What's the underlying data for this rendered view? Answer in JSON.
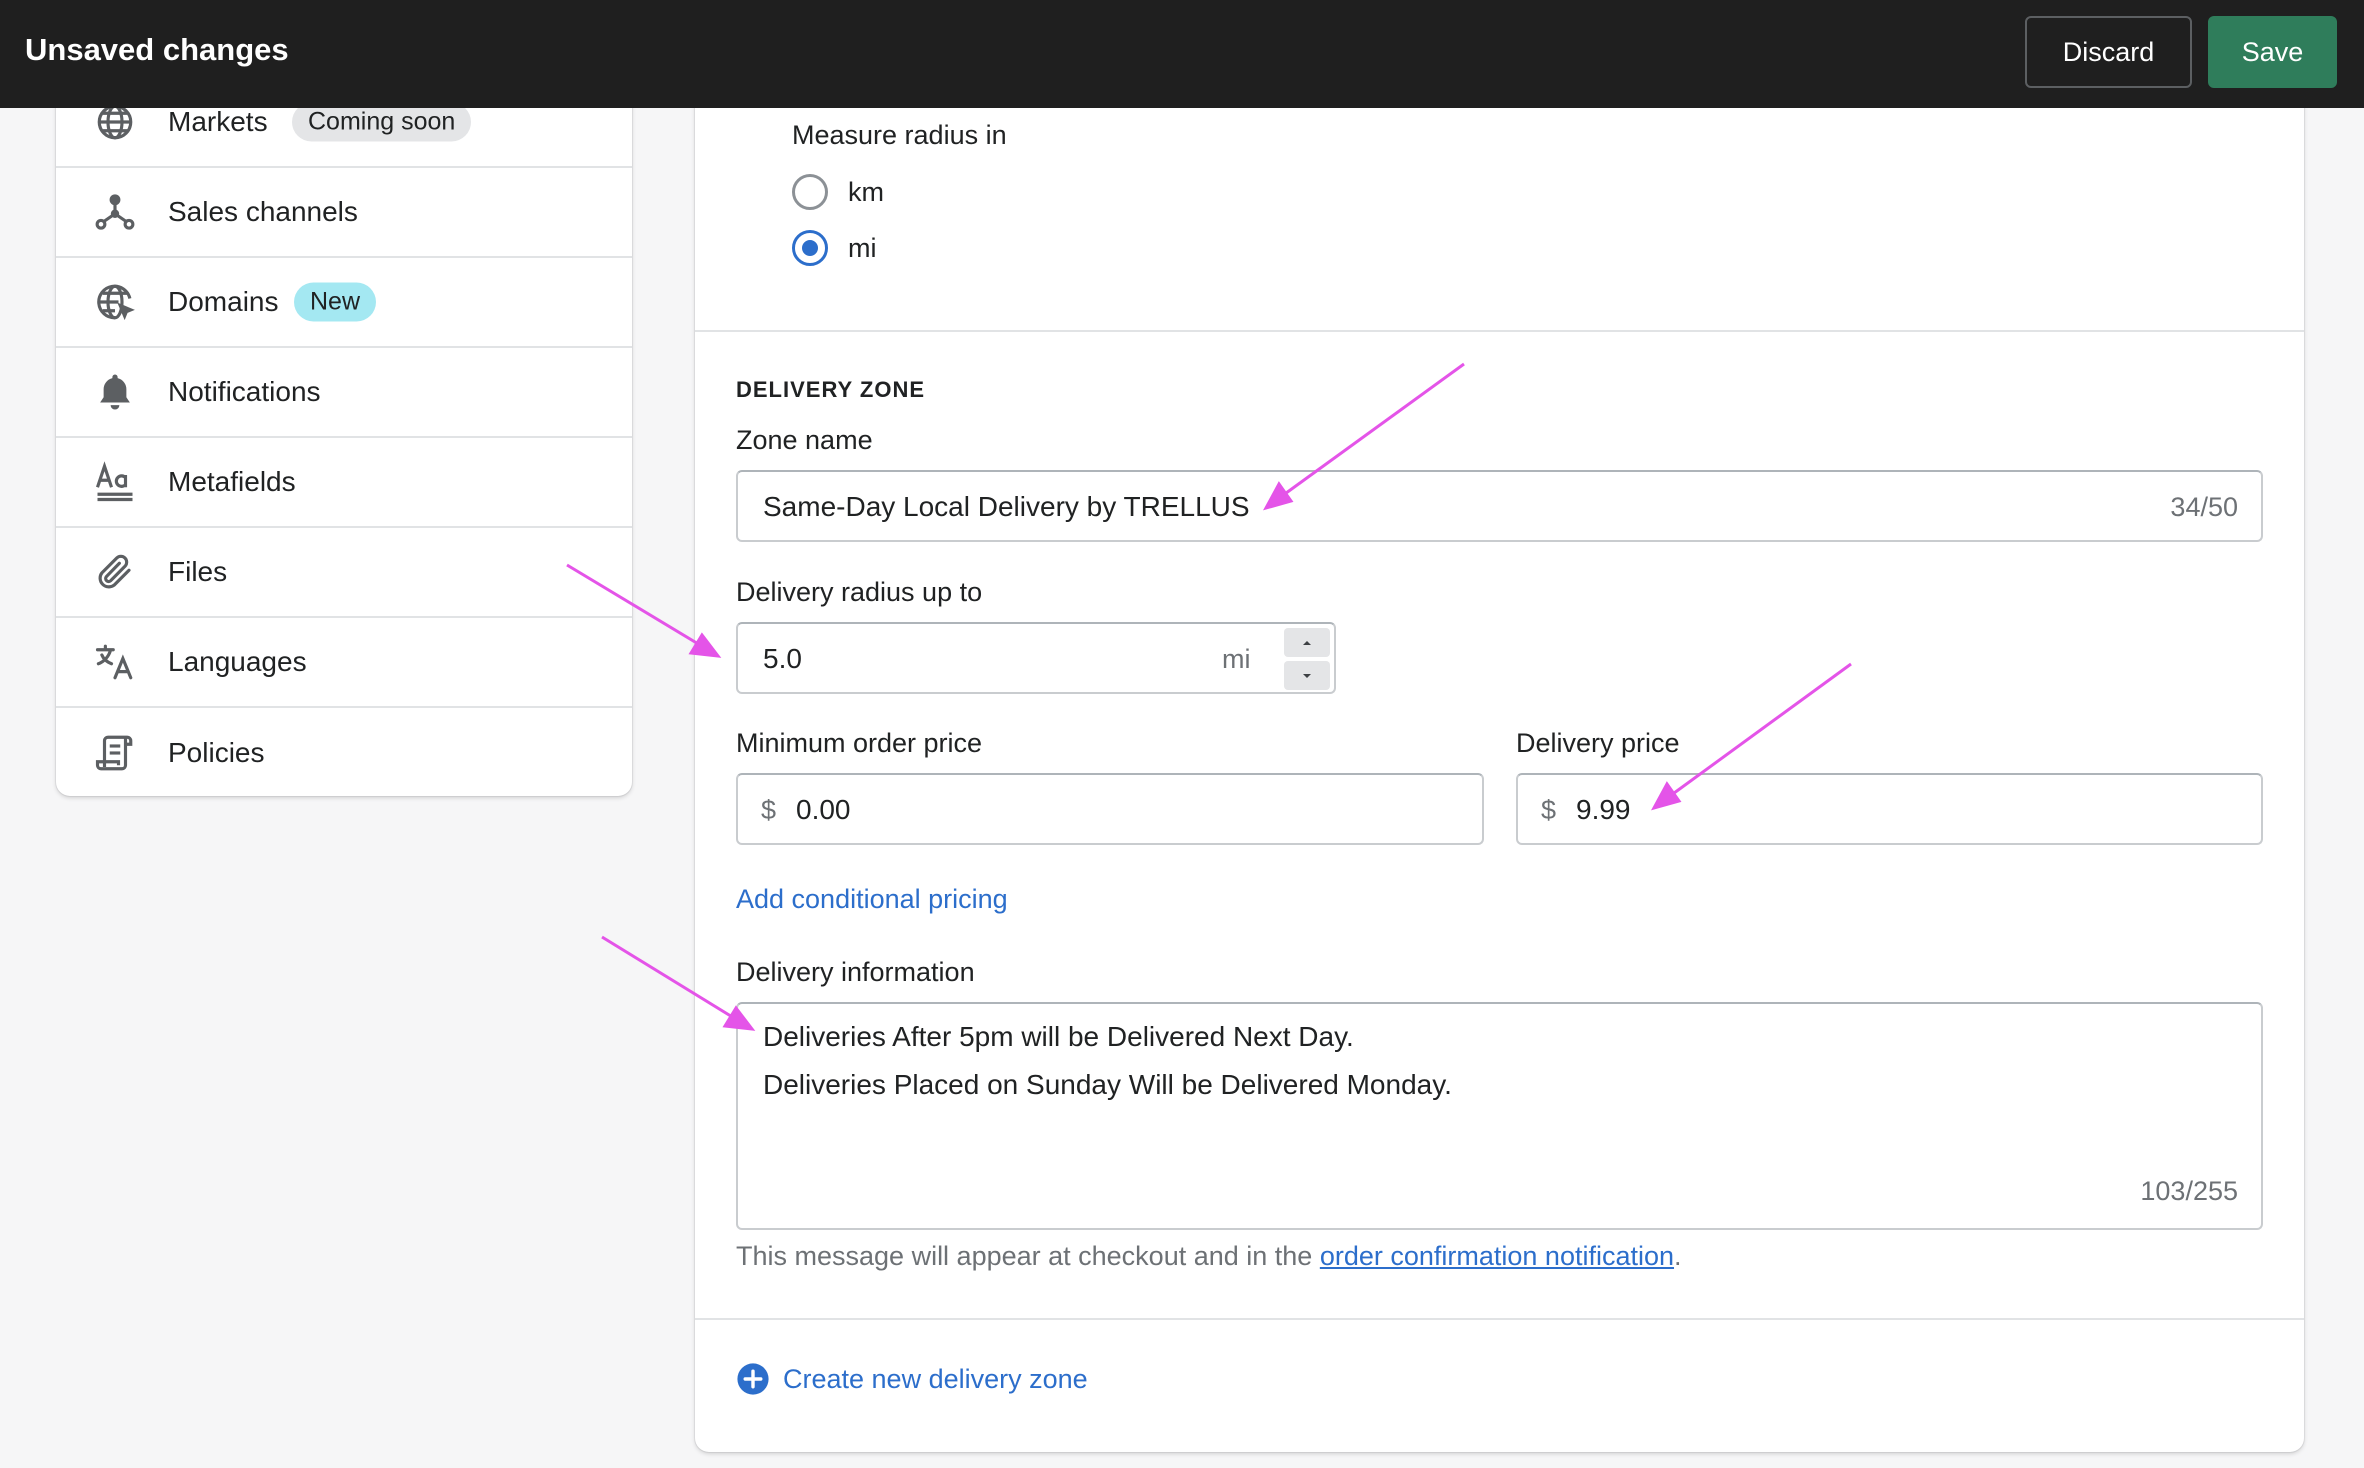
{
  "topbar": {
    "title": "Unsaved changes",
    "discard_label": "Discard",
    "save_label": "Save"
  },
  "sidebar": {
    "items": [
      {
        "label": "Markets",
        "icon": "globe-icon",
        "badge": "Coming soon"
      },
      {
        "label": "Sales channels",
        "icon": "sales-channels-icon"
      },
      {
        "label": "Domains",
        "icon": "globe-cursor-icon",
        "badge": "New"
      },
      {
        "label": "Notifications",
        "icon": "bell-icon"
      },
      {
        "label": "Metafields",
        "icon": "metafields-icon"
      },
      {
        "label": "Files",
        "icon": "paperclip-icon"
      },
      {
        "label": "Languages",
        "icon": "translate-icon"
      },
      {
        "label": "Policies",
        "icon": "policy-scroll-icon"
      }
    ]
  },
  "radius_unit": {
    "label": "Measure radius in",
    "options": [
      "km",
      "mi"
    ],
    "selected": "mi"
  },
  "delivery_zone": {
    "heading": "DELIVERY ZONE",
    "zone_name_label": "Zone name",
    "zone_name_value": "Same-Day Local Delivery by TRELLUS",
    "zone_name_count": "34/50",
    "radius_label": "Delivery radius up to",
    "radius_value": "5.0",
    "radius_suffix": "mi",
    "min_order_label": "Minimum order price",
    "min_order_prefix": "$",
    "min_order_value": "0.00",
    "delivery_price_label": "Delivery price",
    "delivery_price_prefix": "$",
    "delivery_price_value": "9.99",
    "add_conditional_pricing": "Add conditional pricing",
    "info_label": "Delivery information",
    "info_line_1": "Deliveries After 5pm will be Delivered Next Day.",
    "info_line_2": "Deliveries Placed on Sunday Will be Delivered Monday.",
    "info_count": "103/255",
    "help_text_before": "This message will appear at checkout and in the ",
    "help_link": "order confirmation notification",
    "help_text_after": "."
  },
  "create_zone_label": "Create new delivery zone",
  "colors": {
    "topbar": "#1f1f1f",
    "save": "#2f7d5b",
    "link": "#2c6ecb",
    "annotation_arrow": "#e454e8",
    "badge_new": "#a4e8f2",
    "badge_grey": "#e4e5e7"
  }
}
